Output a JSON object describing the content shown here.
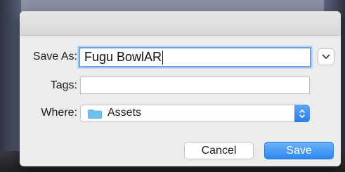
{
  "dialog": {
    "save_as": {
      "label": "Save As:",
      "value": "Fugu BowlAR"
    },
    "tags": {
      "label": "Tags:",
      "value": ""
    },
    "where": {
      "label": "Where:",
      "value": "Assets",
      "icon": "folder-icon"
    },
    "buttons": {
      "cancel": "Cancel",
      "save": "Save"
    }
  },
  "colors": {
    "accent": "#2f86ef",
    "focus_ring": "#6aa2ea",
    "folder": "#6cc0f0",
    "dialog_bg": "#ececec"
  },
  "icons": {
    "expand": "chevron-down-icon",
    "stepper": "up-down-arrows-icon"
  }
}
